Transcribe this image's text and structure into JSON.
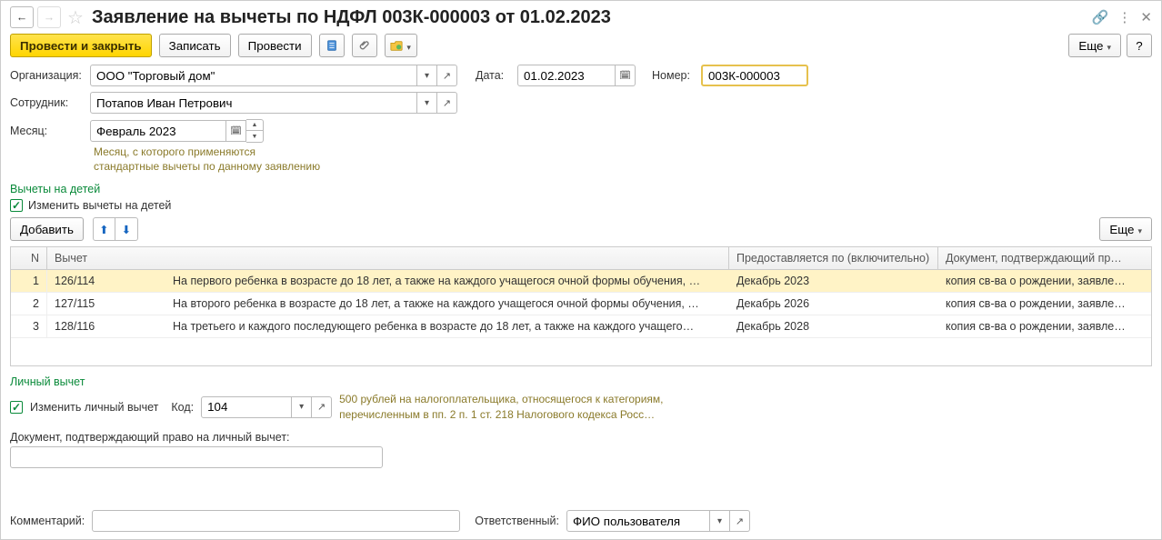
{
  "header": {
    "title": "Заявление на вычеты по НДФЛ 003К-000003 от 01.02.2023"
  },
  "toolbar": {
    "post_and_close": "Провести и закрыть",
    "save": "Записать",
    "post": "Провести",
    "more": "Еще"
  },
  "labels": {
    "org": "Организация:",
    "date": "Дата:",
    "number": "Номер:",
    "employee": "Сотрудник:",
    "month": "Месяц:",
    "month_hint_l1": "Месяц, с которого применяются",
    "month_hint_l2": "стандартные вычеты по данному заявлению",
    "children_section": "Вычеты на детей",
    "change_children": "Изменить вычеты на детей",
    "add": "Добавить",
    "more2": "Еще",
    "personal_section": "Личный вычет",
    "change_personal": "Изменить личный вычет",
    "code": "Код:",
    "personal_hint_l1": "500 рублей на налогоплательщика, относящегося к категориям,",
    "personal_hint_l2": "перечисленным в пп. 2 п. 1 ст. 218 Налогового кодекса Росс…",
    "doc_personal": "Документ, подтверждающий право на личный вычет:",
    "comment": "Комментарий:",
    "responsible": "Ответственный:"
  },
  "fields": {
    "org": "ООО \"Торговый дом\"",
    "date": "01.02.2023",
    "number": "003К-000003",
    "employee": "Потапов Иван Петрович",
    "month": "Февраль 2023",
    "personal_code": "104",
    "doc_personal": "",
    "comment": "",
    "responsible": "ФИО пользователя"
  },
  "grid": {
    "cols": {
      "n": "N",
      "code": "Вычет",
      "desc": "",
      "until": "Предоставляется по (включительно)",
      "doc": "Документ, подтверждающий пр…"
    },
    "rows": [
      {
        "n": "1",
        "code": "126/114",
        "desc": "На первого ребенка в возрасте до 18 лет, а также на каждого учащегося очной формы обучения, …",
        "until": "Декабрь 2023",
        "doc": "копия св-ва о рождении, заявле…",
        "selected": true
      },
      {
        "n": "2",
        "code": "127/115",
        "desc": "На второго ребенка в возрасте до 18 лет, а также на каждого учащегося очной формы обучения, …",
        "until": "Декабрь 2026",
        "doc": "копия св-ва о рождении, заявле…",
        "selected": false
      },
      {
        "n": "3",
        "code": "128/116",
        "desc": "На третьего и каждого последующего ребенка в возрасте до 18 лет, а также на каждого учащего…",
        "until": "Декабрь 2028",
        "doc": "копия св-ва о рождении, заявле…",
        "selected": false
      }
    ]
  }
}
